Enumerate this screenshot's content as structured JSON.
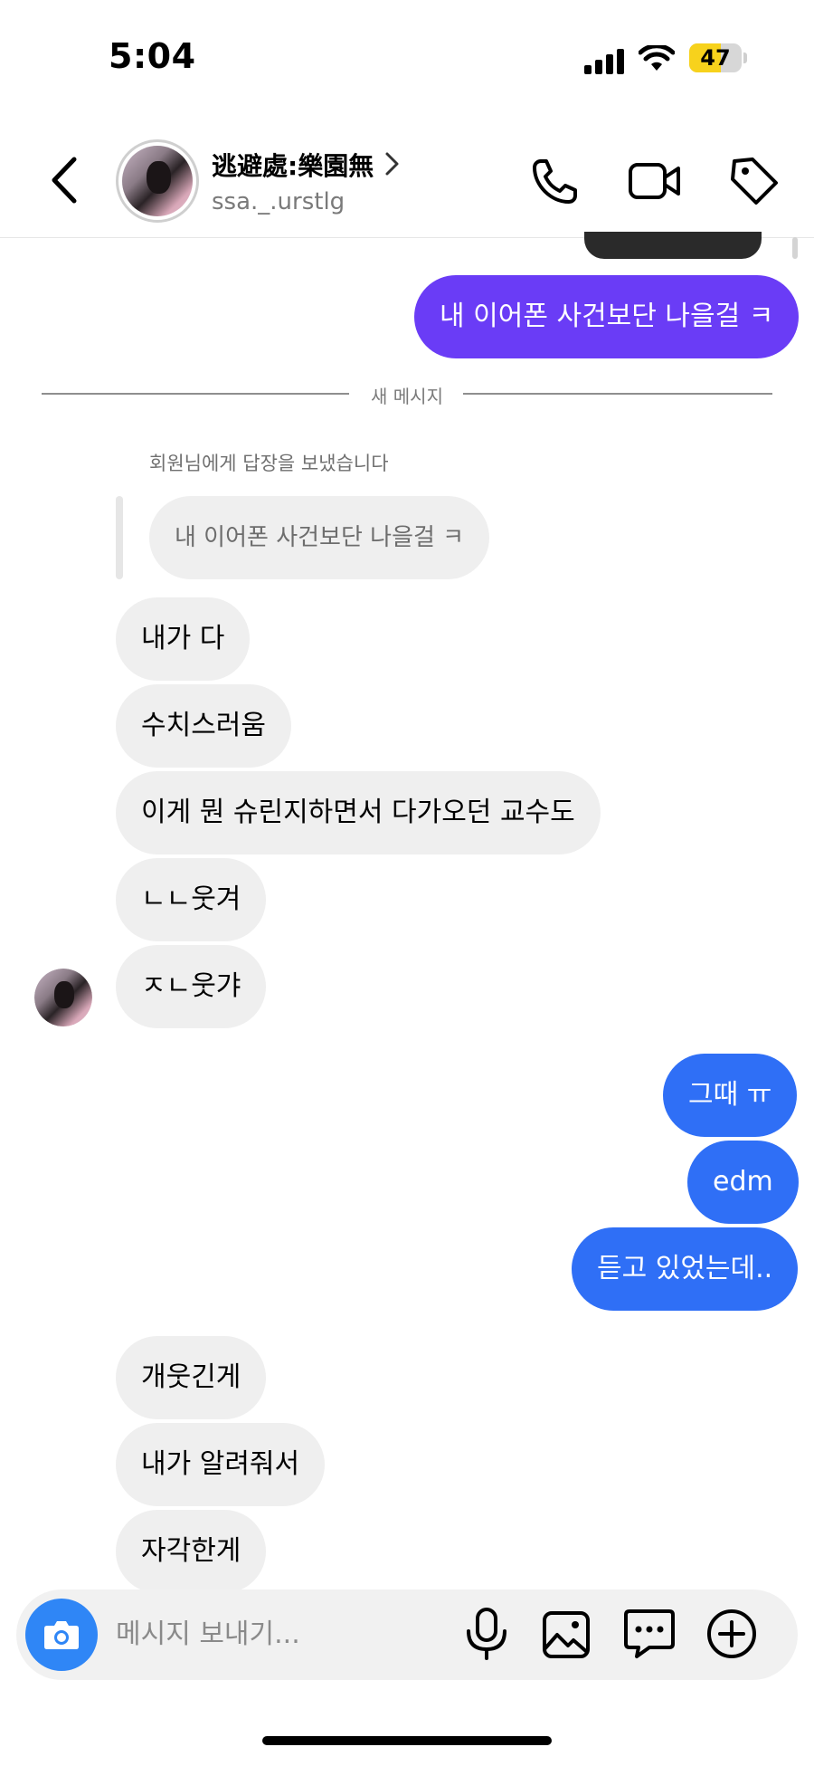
{
  "status_bar": {
    "time": "5:04",
    "battery": "47"
  },
  "header": {
    "name": "逃避處:樂園無",
    "username": "ssa._.urstlg"
  },
  "thread": {
    "sent_before_divider": "내 이어폰 사건보단 나을걸 ㅋ",
    "new_messages_label": "새 메시지",
    "reply_note": "회원님에게 답장을 보냈습니다",
    "quoted_text": "내 이어폰 사건보단 나을걸 ㅋ",
    "received_group1": [
      "내가 다",
      "수치스러움",
      "이게 뭔 슈린지하면서 다가오던 교수도",
      "ㄴㄴ웃겨",
      "ㅈㄴ웃갸"
    ],
    "sent_group": [
      "그때 ㅠ",
      "edm",
      "듣고 있었는데.."
    ],
    "received_group2": [
      "개웃긴게",
      "내가 알려줘서",
      "자각한게"
    ]
  },
  "composer": {
    "placeholder": "메시지 보내기..."
  },
  "colors": {
    "sent_purple": "#6a3cf6",
    "sent_blue": "#2f6ff6",
    "received_bubble": "#efefef",
    "camera_button": "#2f86f6",
    "battery": "#f7d21c"
  },
  "icons": [
    "back-arrow-icon",
    "chevron-right-icon",
    "phone-icon",
    "video-camera-icon",
    "tag-icon",
    "camera-icon",
    "microphone-icon",
    "image-icon",
    "sticker-chat-icon",
    "plus-circle-icon",
    "signal-icon",
    "wifi-icon",
    "battery-icon"
  ]
}
